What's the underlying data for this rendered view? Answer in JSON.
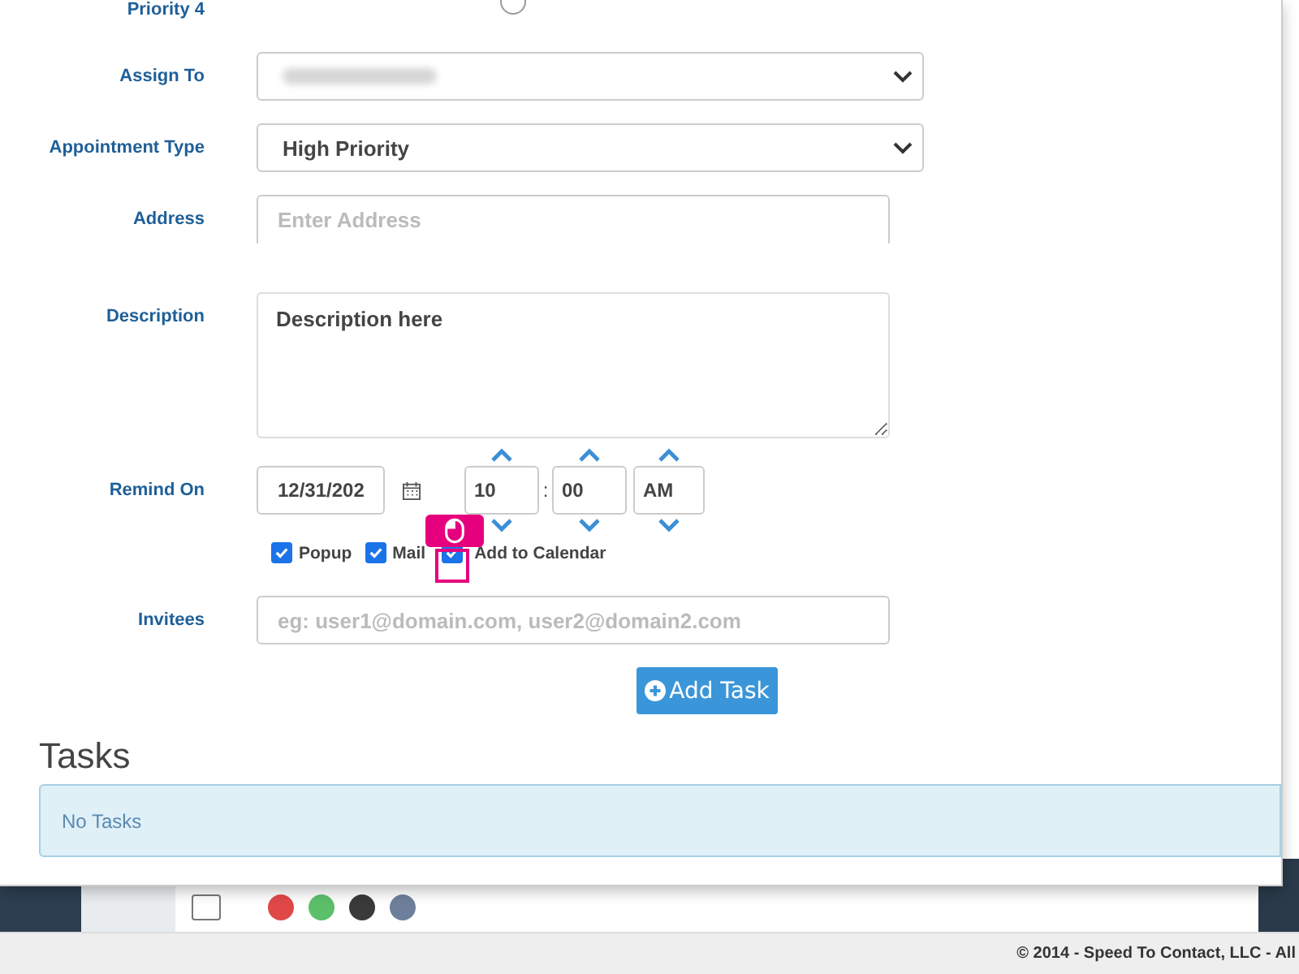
{
  "form": {
    "partial_label": "Priority 4",
    "priority_radio": {
      "selected": false
    },
    "assign_to": {
      "label": "Assign To"
    },
    "appointment_type": {
      "label": "Appointment Type",
      "value": "High Priority"
    },
    "address": {
      "label": "Address",
      "placeholder": "Enter Address"
    },
    "description": {
      "label": "Description",
      "value": "Description here"
    },
    "remind_on": {
      "label": "Remind On",
      "date": "12/31/202",
      "hour": "10",
      "separator": ":",
      "minute": "00",
      "meridiem": "AM"
    },
    "reminders": [
      {
        "label": "Popup",
        "checked": true
      },
      {
        "label": "Mail",
        "checked": true
      },
      {
        "label": "Add to Calendar",
        "checked": true
      }
    ],
    "invitees": {
      "label": "Invitees",
      "placeholder": "eg: user1@domain.com, user2@domain2.com"
    },
    "add_button": "Add Task"
  },
  "tasks": {
    "title": "Tasks",
    "empty_message": "No Tasks"
  },
  "background_rows": [
    {
      "checked": false
    }
  ],
  "footer": "© 2014 - Speed To Contact, LLC - All"
}
